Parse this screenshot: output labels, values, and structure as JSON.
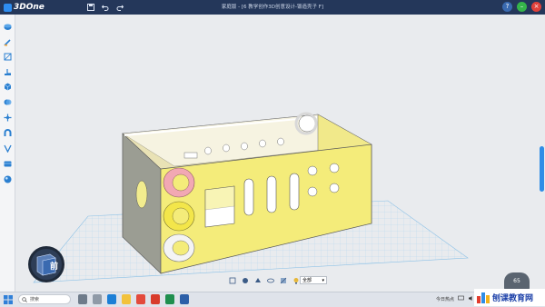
{
  "app": {
    "name": "3DOne",
    "window_title": "家庭版 - [6 教学创作3D创意设计-锻造壳子 F]"
  },
  "titlebar_icons": [
    "save-icon",
    "undo-icon",
    "redo-icon"
  ],
  "window_controls": [
    "help-icon",
    "minimize-icon",
    "close-icon"
  ],
  "left_tools": [
    "sketch-primitive-icon",
    "draw-icon",
    "special-function-icon",
    "grid-icon",
    "basic-edit-icon",
    "combine-icon",
    "move-icon",
    "magnet-icon",
    "distance-measure-icon",
    "material-icon",
    "render-icon"
  ],
  "viewcube": {
    "label": "前"
  },
  "viewbar": {
    "icons": [
      "view-fit-icon",
      "render-mode-icon",
      "view-top-icon",
      "view-orbit-icon",
      "section-icon",
      "light-icon"
    ],
    "view_select": "全部"
  },
  "zoom": {
    "value": "65"
  },
  "taskbar": {
    "search_placeholder": "搜索",
    "apps": [
      "widget-icon",
      "taskview-icon",
      "edge-icon",
      "folder-icon",
      "chrome-icon",
      "wps-icon",
      "excel-icon",
      "3done-icon"
    ],
    "weather": "今日热点",
    "tray_icons": [
      "network-icon",
      "sound-icon",
      "chinese-ime-icon"
    ]
  },
  "watermark": {
    "text": "刨课教育网"
  },
  "colors": {
    "title_bar": "#24375a",
    "accent": "#2f8de6",
    "model_yellow": "#f4ec7a",
    "ring_pink": "#f2a8b3",
    "ring_yellow": "#f3e64a",
    "ring_white": "#f4f4f4",
    "grid": "#a9d3ef"
  }
}
